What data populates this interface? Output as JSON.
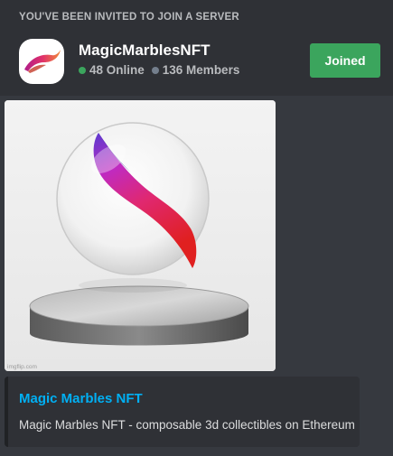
{
  "invite": {
    "heading": "YOU'VE BEEN INVITED TO JOIN A SERVER",
    "server_name": "MagicMarblesNFT",
    "online_count": "48 Online",
    "member_count": "136 Members",
    "button_label": "Joined",
    "icon": "magic-marbles-server-icon"
  },
  "embed": {
    "image_watermark": "imgflip.com",
    "image_subject": "marble-on-pedestal-image",
    "title": "Magic Marbles NFT",
    "description": "Magic Marbles NFT - composable 3d collectibles on Ethereum"
  },
  "colors": {
    "background": "#36393f",
    "card": "#2f3136",
    "joined_green": "#3ba55d",
    "online_dot": "#3ba55d",
    "members_dot": "#747f8d",
    "link_blue": "#00b0f4"
  }
}
